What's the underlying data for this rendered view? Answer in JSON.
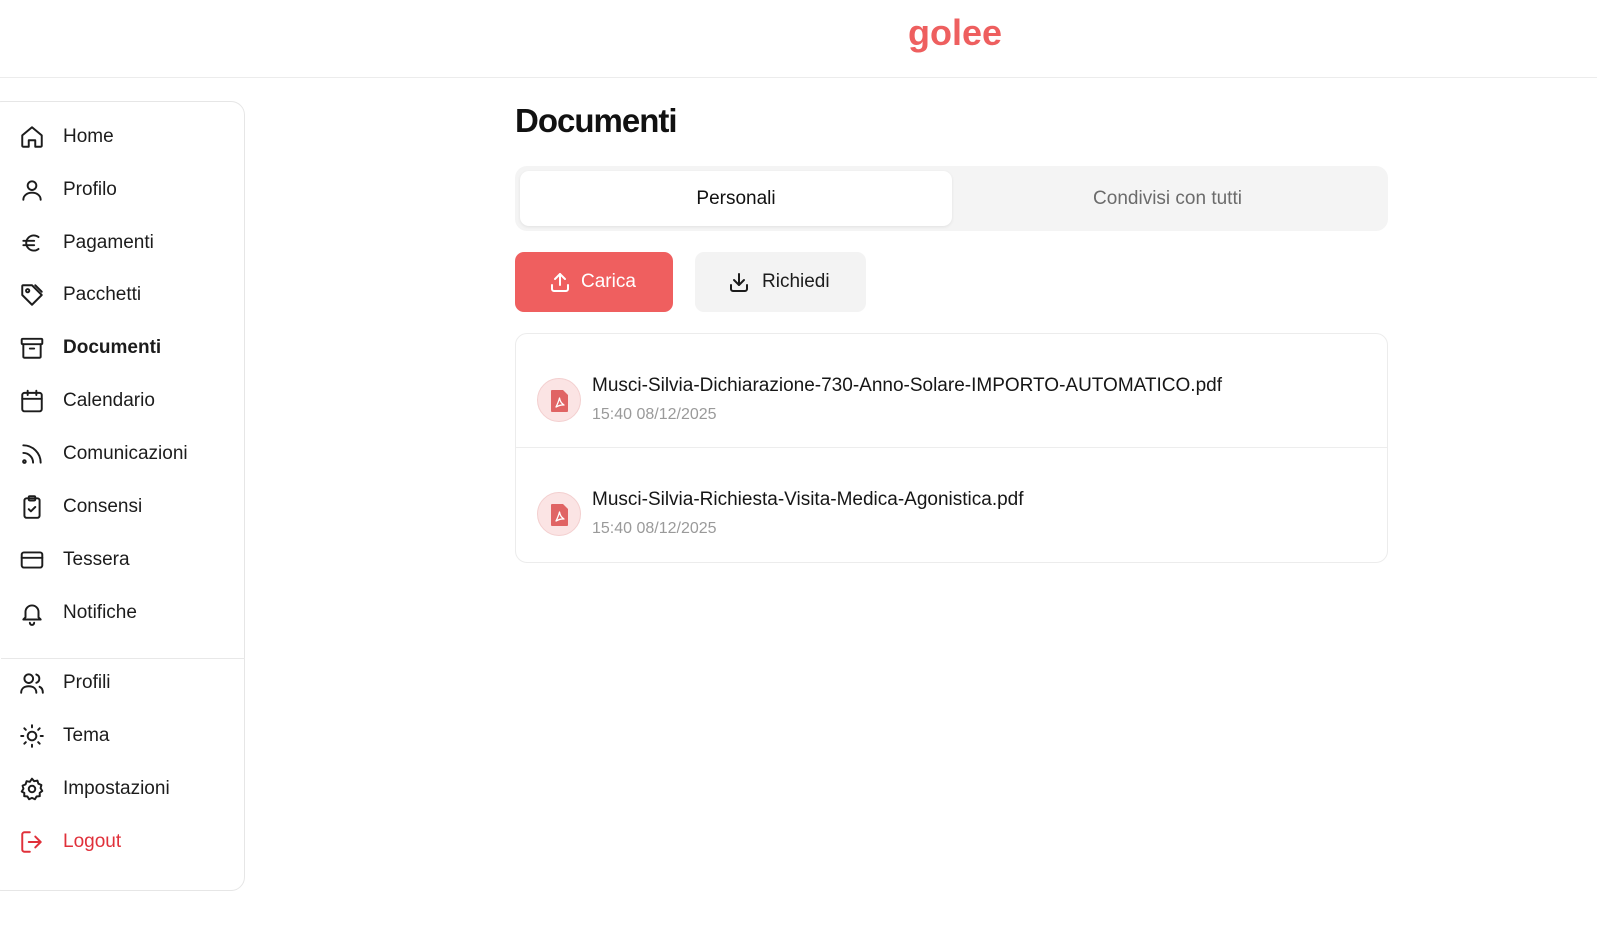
{
  "app": {
    "logo": "golee"
  },
  "sidebar": {
    "items": [
      {
        "label": "Home",
        "icon": "home-icon"
      },
      {
        "label": "Profilo",
        "icon": "user-icon"
      },
      {
        "label": "Pagamenti",
        "icon": "euro-icon"
      },
      {
        "label": "Pacchetti",
        "icon": "tag-icon"
      },
      {
        "label": "Documenti",
        "icon": "archive-icon",
        "active": true
      },
      {
        "label": "Calendario",
        "icon": "calendar-icon"
      },
      {
        "label": "Comunicazioni",
        "icon": "rss-icon"
      },
      {
        "label": "Consensi",
        "icon": "clipboard-check-icon"
      },
      {
        "label": "Tessera",
        "icon": "card-icon"
      },
      {
        "label": "Notifiche",
        "icon": "bell-icon"
      }
    ],
    "bottom_items": [
      {
        "label": "Profili",
        "icon": "users-icon"
      },
      {
        "label": "Tema",
        "icon": "sun-icon"
      },
      {
        "label": "Impostazioni",
        "icon": "gear-icon"
      },
      {
        "label": "Logout",
        "icon": "logout-icon"
      }
    ]
  },
  "main": {
    "title": "Documenti",
    "tabs": [
      {
        "label": "Personali",
        "selected": true
      },
      {
        "label": "Condivisi con tutti",
        "selected": false
      }
    ],
    "actions": {
      "upload_label": "Carica",
      "request_label": "Richiedi"
    },
    "documents": [
      {
        "name": "Musci-Silvia-Dichiarazione-730-Anno-Solare-IMPORTO-AUTOMATICO.pdf",
        "time": "15:40 08/12/2025",
        "icon": "pdf-icon"
      },
      {
        "name": "Musci-Silvia-Richiesta-Visita-Medica-Agonistica.pdf",
        "time": "15:40 08/12/2025",
        "icon": "pdf-icon"
      }
    ]
  },
  "colors": {
    "brand": "#ee5f5f",
    "logout": "#e0303a",
    "muted_text": "#9a9a9a"
  }
}
